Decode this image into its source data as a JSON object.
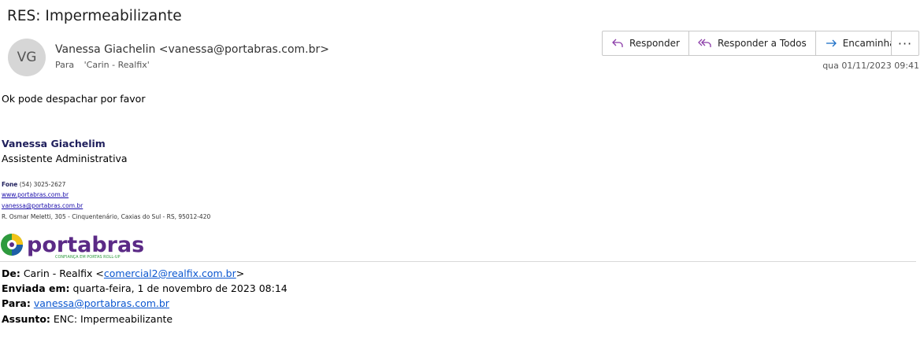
{
  "email": {
    "subject": "RES: Impermeabilizante",
    "avatar_initials": "VG",
    "from_display": "Vanessa Giachelin <vanessa@portabras.com.br>",
    "to_label": "Para",
    "to_value": "'Carin - Realfix'",
    "date": "qua 01/11/2023 09:41"
  },
  "actions": {
    "reply": "Responder",
    "reply_all": "Responder a Todos",
    "forward": "Encaminhar",
    "more": "···"
  },
  "body": {
    "text": "Ok pode despachar por favor"
  },
  "signature": {
    "name": "Vanessa Giachelim",
    "role": "Assistente Administrativa",
    "phone_label": "Fone",
    "phone": " (54) 3025-2627",
    "website": "www.portabras.com.br",
    "email": "vanessa@portabras.com.br",
    "address": "R. Osmar Meletti, 305 - Cinquentenário, Caxias do Sul - RS, 95012-420"
  },
  "logo": {
    "name": "portabras",
    "tagline": "CONFIANÇA EM PORTAS ROLL-UP",
    "colors": {
      "text": "#5b2a86",
      "green": "#2e9a3e",
      "yellow": "#f2c318",
      "blue": "#1d5fa8"
    }
  },
  "forwarded": {
    "from_label": "De:",
    "from_name": " Carin - Realfix <",
    "from_email": "comercial2@realfix.com.br",
    "from_close": ">",
    "sent_label": "Enviada em:",
    "sent_value": " quarta-feira, 1 de novembro de 2023 08:14",
    "to_label": "Para:",
    "to_email": "vanessa@portabras.com.br",
    "subject_label": "Assunto:",
    "subject_value": " ENC: Impermeabilizante"
  },
  "colors": {
    "accent_purple": "#8b3ca8",
    "link": "#0b57d0"
  }
}
